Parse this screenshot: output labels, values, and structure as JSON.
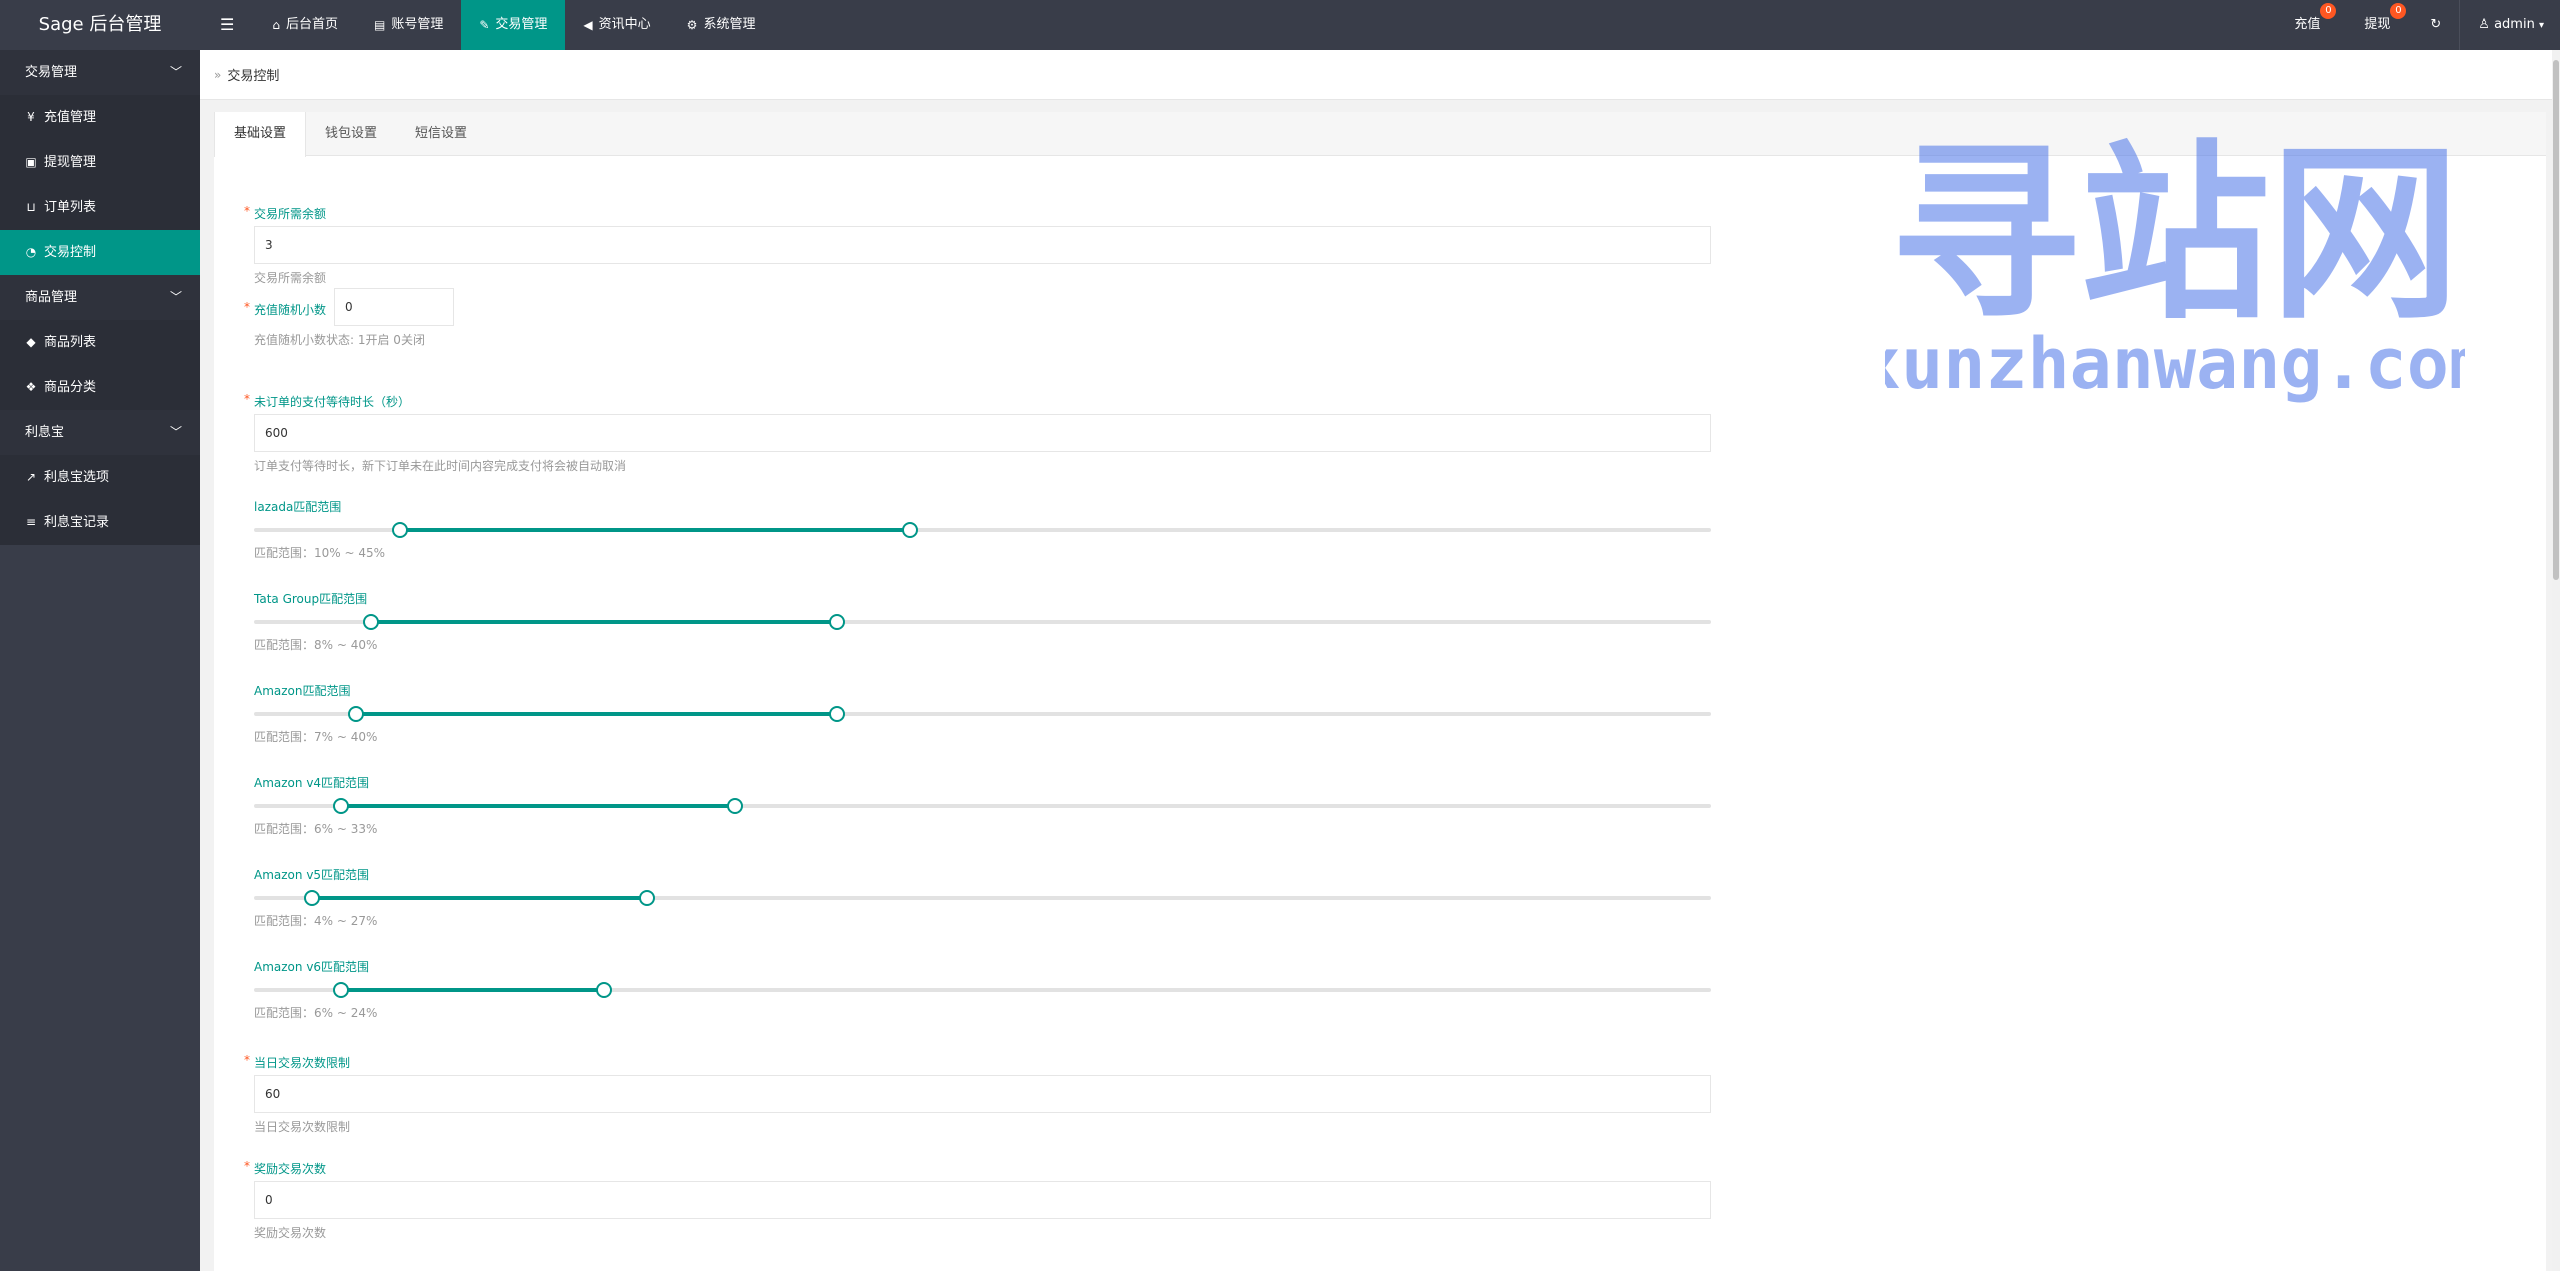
{
  "header": {
    "logo": "Sage 后台管理",
    "toggle_icon": "menu-icon",
    "nav": [
      {
        "label": "后台首页",
        "icon": "home-icon"
      },
      {
        "label": "账号管理",
        "icon": "id-card-icon"
      },
      {
        "label": "交易管理",
        "icon": "gavel-icon",
        "active": true
      },
      {
        "label": "资讯中心",
        "icon": "bullhorn-icon"
      },
      {
        "label": "系统管理",
        "icon": "gears-icon"
      }
    ],
    "right": {
      "recharge": "充值",
      "recharge_badge": "0",
      "withdraw": "提现",
      "withdraw_badge": "0",
      "refresh_icon": "refresh-icon",
      "user": "admin"
    }
  },
  "sidebar": {
    "groups": [
      {
        "label": "交易管理",
        "items": [
          {
            "label": "充值管理",
            "icon": "yen-icon"
          },
          {
            "label": "提现管理",
            "icon": "money-icon"
          },
          {
            "label": "订单列表",
            "icon": "cart-icon"
          },
          {
            "label": "交易控制",
            "icon": "dashboard-icon",
            "active": true
          }
        ]
      },
      {
        "label": "商品管理",
        "items": [
          {
            "label": "商品列表",
            "icon": "cube-icon"
          },
          {
            "label": "商品分类",
            "icon": "cubes-icon"
          }
        ]
      },
      {
        "label": "利息宝",
        "items": [
          {
            "label": "利息宝选项",
            "icon": "line-chart-icon"
          },
          {
            "label": "利息宝记录",
            "icon": "list-icon"
          }
        ]
      }
    ]
  },
  "breadcrumb": "交易控制",
  "tabs": [
    "基础设置",
    "钱包设置",
    "短信设置"
  ],
  "form": {
    "min_balance": {
      "label": "交易所需余额",
      "value": "3",
      "tip": "交易所需余额"
    },
    "random_decimal": {
      "label": "充值随机小数",
      "value": "0",
      "tip": "充值随机小数状态: 1开启 0关闭"
    },
    "pay_wait": {
      "label": "未订单的支付等待时长（秒）",
      "value": "600",
      "tip": "订单支付等待时长，新下订单未在此时间内容完成支付将会被自动取消"
    },
    "sliders": [
      {
        "label": "lazada匹配范围",
        "min": 10,
        "max": 45,
        "tip": "匹配范围：10% ~ 45%"
      },
      {
        "label": "Tata Group匹配范围",
        "min": 8,
        "max": 40,
        "tip": "匹配范围：8% ~ 40%"
      },
      {
        "label": "Amazon匹配范围",
        "min": 7,
        "max": 40,
        "tip": "匹配范围：7% ~ 40%"
      },
      {
        "label": "Amazon v4匹配范围",
        "min": 6,
        "max": 33,
        "tip": "匹配范围：6% ~ 33%"
      },
      {
        "label": "Amazon v5匹配范围",
        "min": 4,
        "max": 27,
        "tip": "匹配范围：4% ~ 27%"
      },
      {
        "label": "Amazon v6匹配范围",
        "min": 6,
        "max": 24,
        "tip": "匹配范围：6% ~ 24%"
      }
    ],
    "daily_limit": {
      "label": "当日交易次数限制",
      "value": "60",
      "tip": "当日交易次数限制"
    },
    "reward_count": {
      "label": "奖励交易次数",
      "value": "0",
      "tip": "奖励交易次数"
    }
  },
  "watermark": {
    "line1": "寻站网",
    "line2": "xunzhanwang.com"
  },
  "colors": {
    "primary": "#009688",
    "header_bg": "#393d49",
    "badge": "#ff5722"
  }
}
